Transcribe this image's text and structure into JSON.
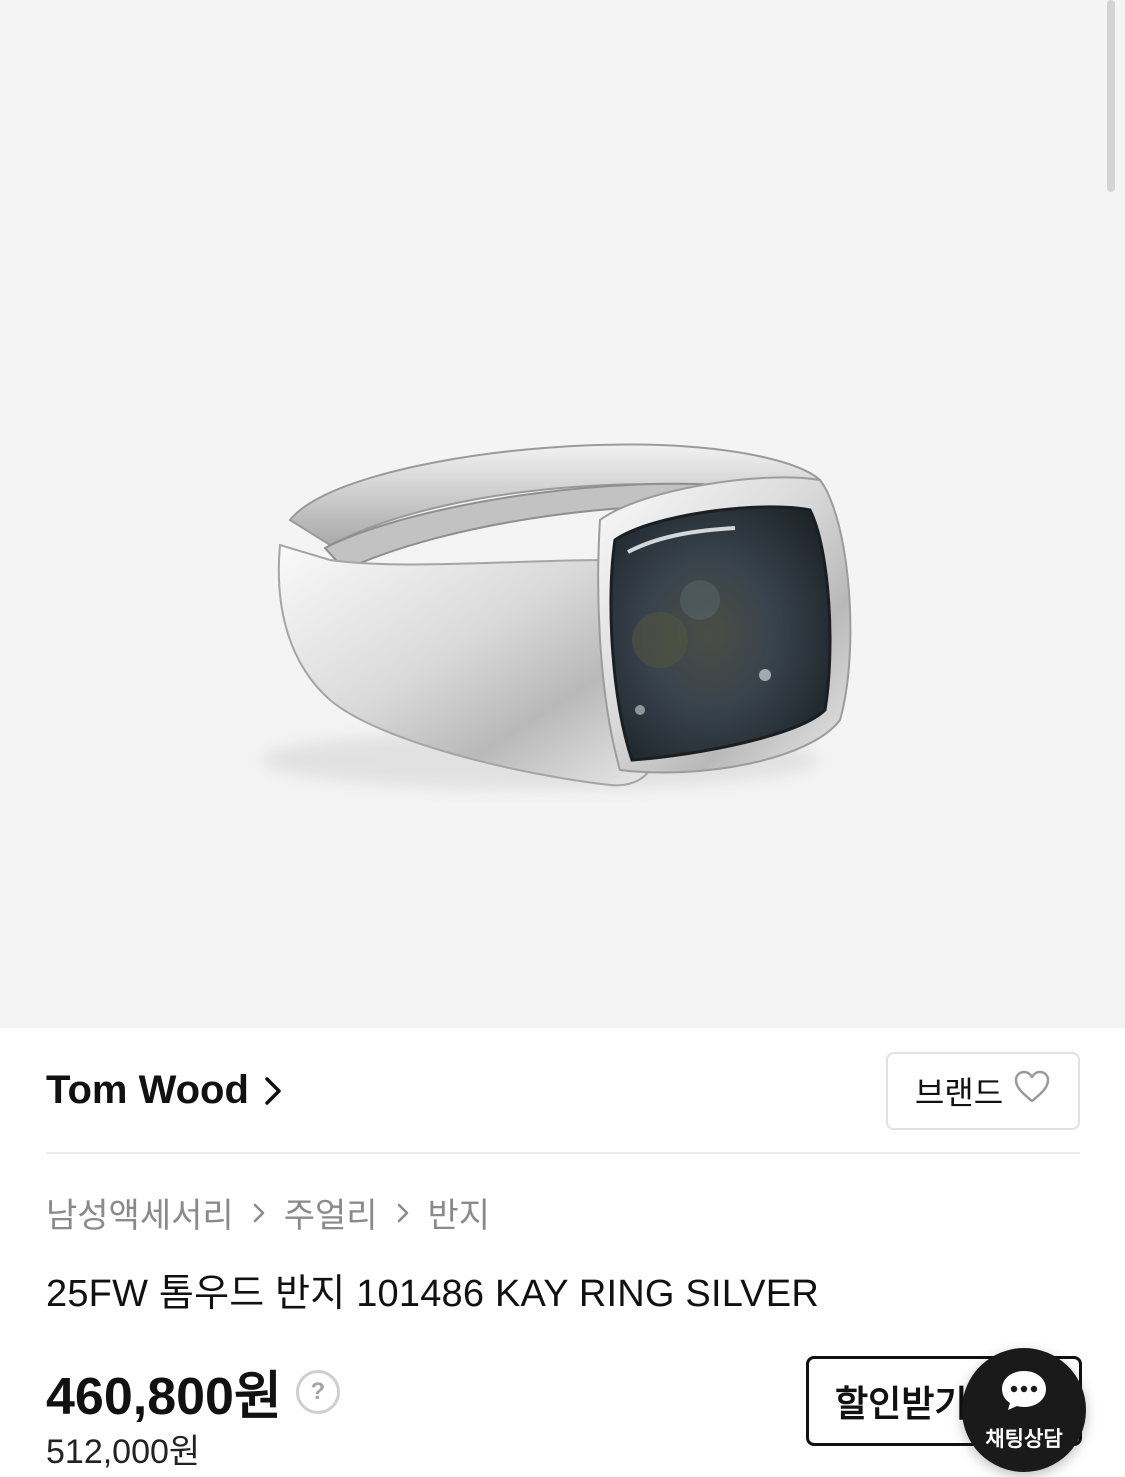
{
  "product": {
    "image_alt": "silver signet ring with labradorite stone",
    "brand": {
      "name": "Tom Wood",
      "follow_label": "브랜드"
    },
    "breadcrumb": [
      "남성액세서리",
      "주얼리",
      "반지"
    ],
    "title": "25FW 톰우드 반지 101486 KAY RING SILVER",
    "price": "460,800원",
    "original_price": "512,000원",
    "help_icon_glyph": "?"
  },
  "actions": {
    "discount_label": "할인받기",
    "chat_label": "채팅상담"
  },
  "icons": {
    "brand_chevron": "chevron-right-icon",
    "brand_favorite": "heart-outline-icon",
    "breadcrumb_separator": "chevron-right-icon",
    "price_help": "question-circle-icon",
    "chat": "chat-bubble-icon"
  },
  "colors": {
    "image_background": "#f4f4f4",
    "text_primary": "#111111",
    "text_secondary": "#8a8a8a",
    "fab_background": "#1a1a1a"
  }
}
